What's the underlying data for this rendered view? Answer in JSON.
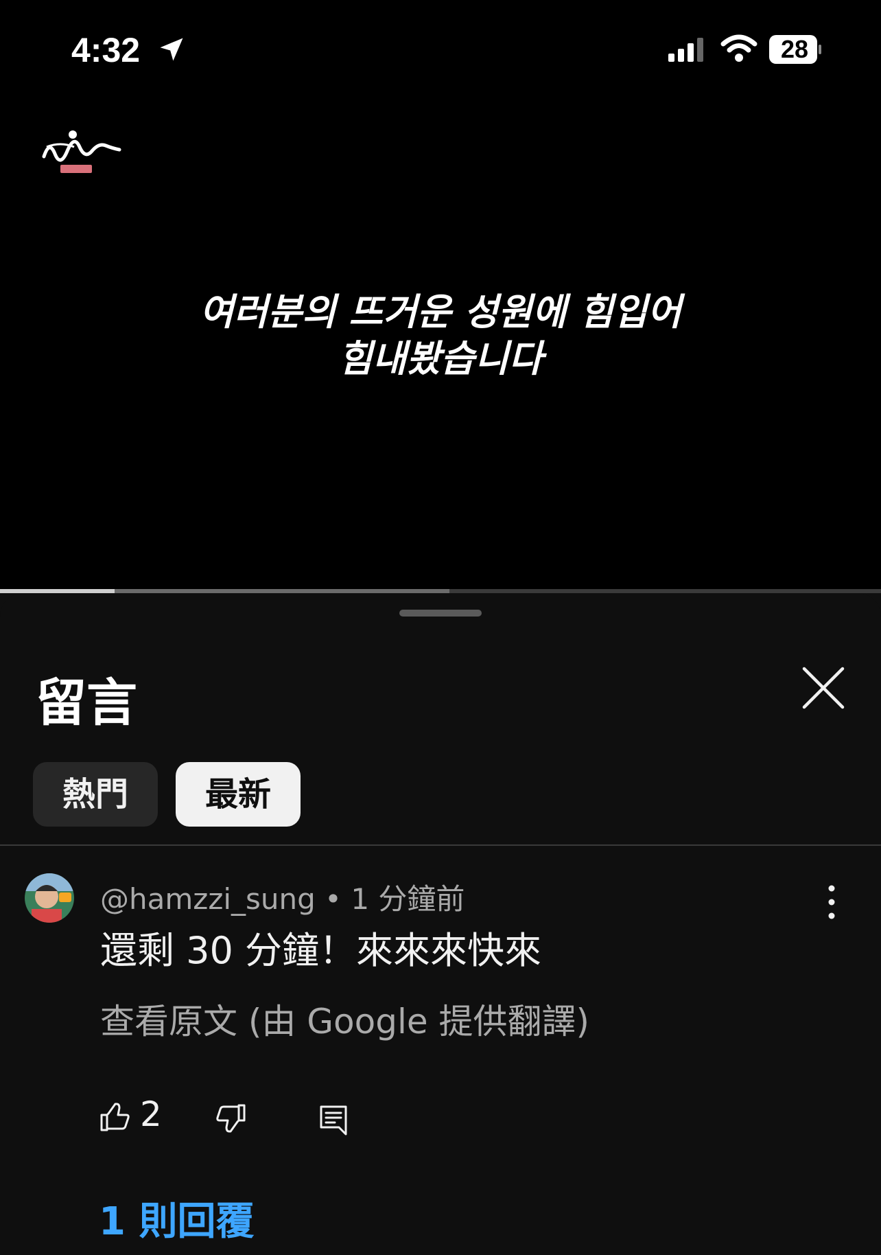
{
  "status_bar": {
    "time": "4:32",
    "battery_level": "28",
    "location_icon": "location-arrow-icon",
    "signal_icon": "cellular-signal-icon",
    "wifi_icon": "wifi-icon",
    "battery_icon": "battery-icon"
  },
  "video": {
    "subtitle_line1": "여러분의 뜨거운 성원에 힘입어",
    "subtitle_line2": "힘내봤습니다",
    "channel_logo": "channel-logo",
    "progress_played": 0.13,
    "progress_buffered": 0.51
  },
  "comments_sheet": {
    "title": "留言",
    "close_icon": "close-icon",
    "sort_chips": [
      {
        "label": "熱門",
        "selected": false
      },
      {
        "label": "最新",
        "selected": true
      }
    ]
  },
  "comment": {
    "author": "@hamzzi_sung",
    "separator": "•",
    "time_ago": "1 分鐘前",
    "text": "還剩 30 分鐘！來來來快來",
    "translate_link": "查看原文 (由 Google 提供翻譯)",
    "like_count": "2",
    "replies_label": "1 則回覆"
  },
  "colors": {
    "background": "#0f0f0f",
    "chip_selected_bg": "#f1f1f1",
    "chip_unselected_bg": "#272727",
    "link_blue": "#3ea6ff",
    "secondary_text": "#aaaaaa"
  }
}
